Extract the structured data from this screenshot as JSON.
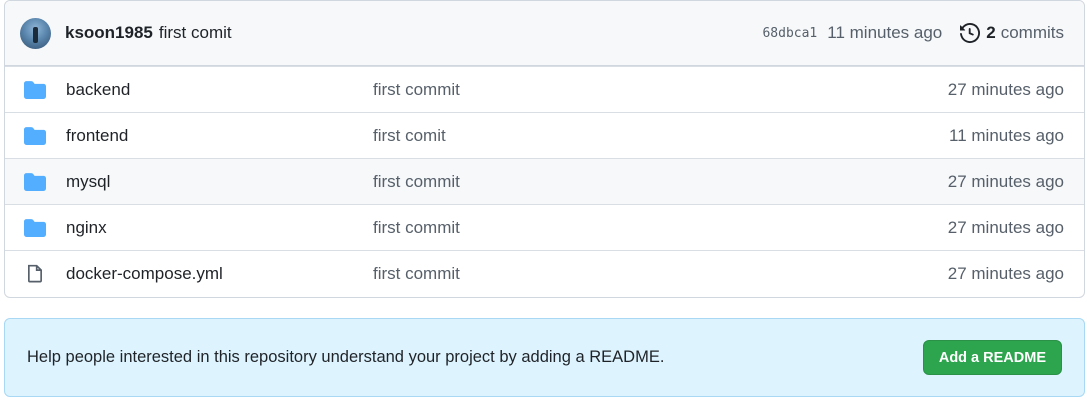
{
  "commit": {
    "author": "ksoon1985",
    "message": "first comit",
    "sha": "68dbca1",
    "time": "11 minutes ago",
    "history_count": "2",
    "history_label": "commits"
  },
  "files": [
    {
      "name": "backend",
      "type": "folder",
      "commit": "first commit",
      "time": "27 minutes ago"
    },
    {
      "name": "frontend",
      "type": "folder",
      "commit": "first comit",
      "time": "11 minutes ago"
    },
    {
      "name": "mysql",
      "type": "folder",
      "commit": "first commit",
      "time": "27 minutes ago"
    },
    {
      "name": "nginx",
      "type": "folder",
      "commit": "first commit",
      "time": "27 minutes ago"
    },
    {
      "name": "docker-compose.yml",
      "type": "file",
      "commit": "first commit",
      "time": "27 minutes ago"
    }
  ],
  "readme": {
    "text": "Help people interested in this repository understand your project by adding a README.",
    "button_label": "Add a README"
  },
  "colors": {
    "folder": "#54aeff",
    "file": "#57606a",
    "button": "#2da44e",
    "banner": "#ddf4ff"
  }
}
